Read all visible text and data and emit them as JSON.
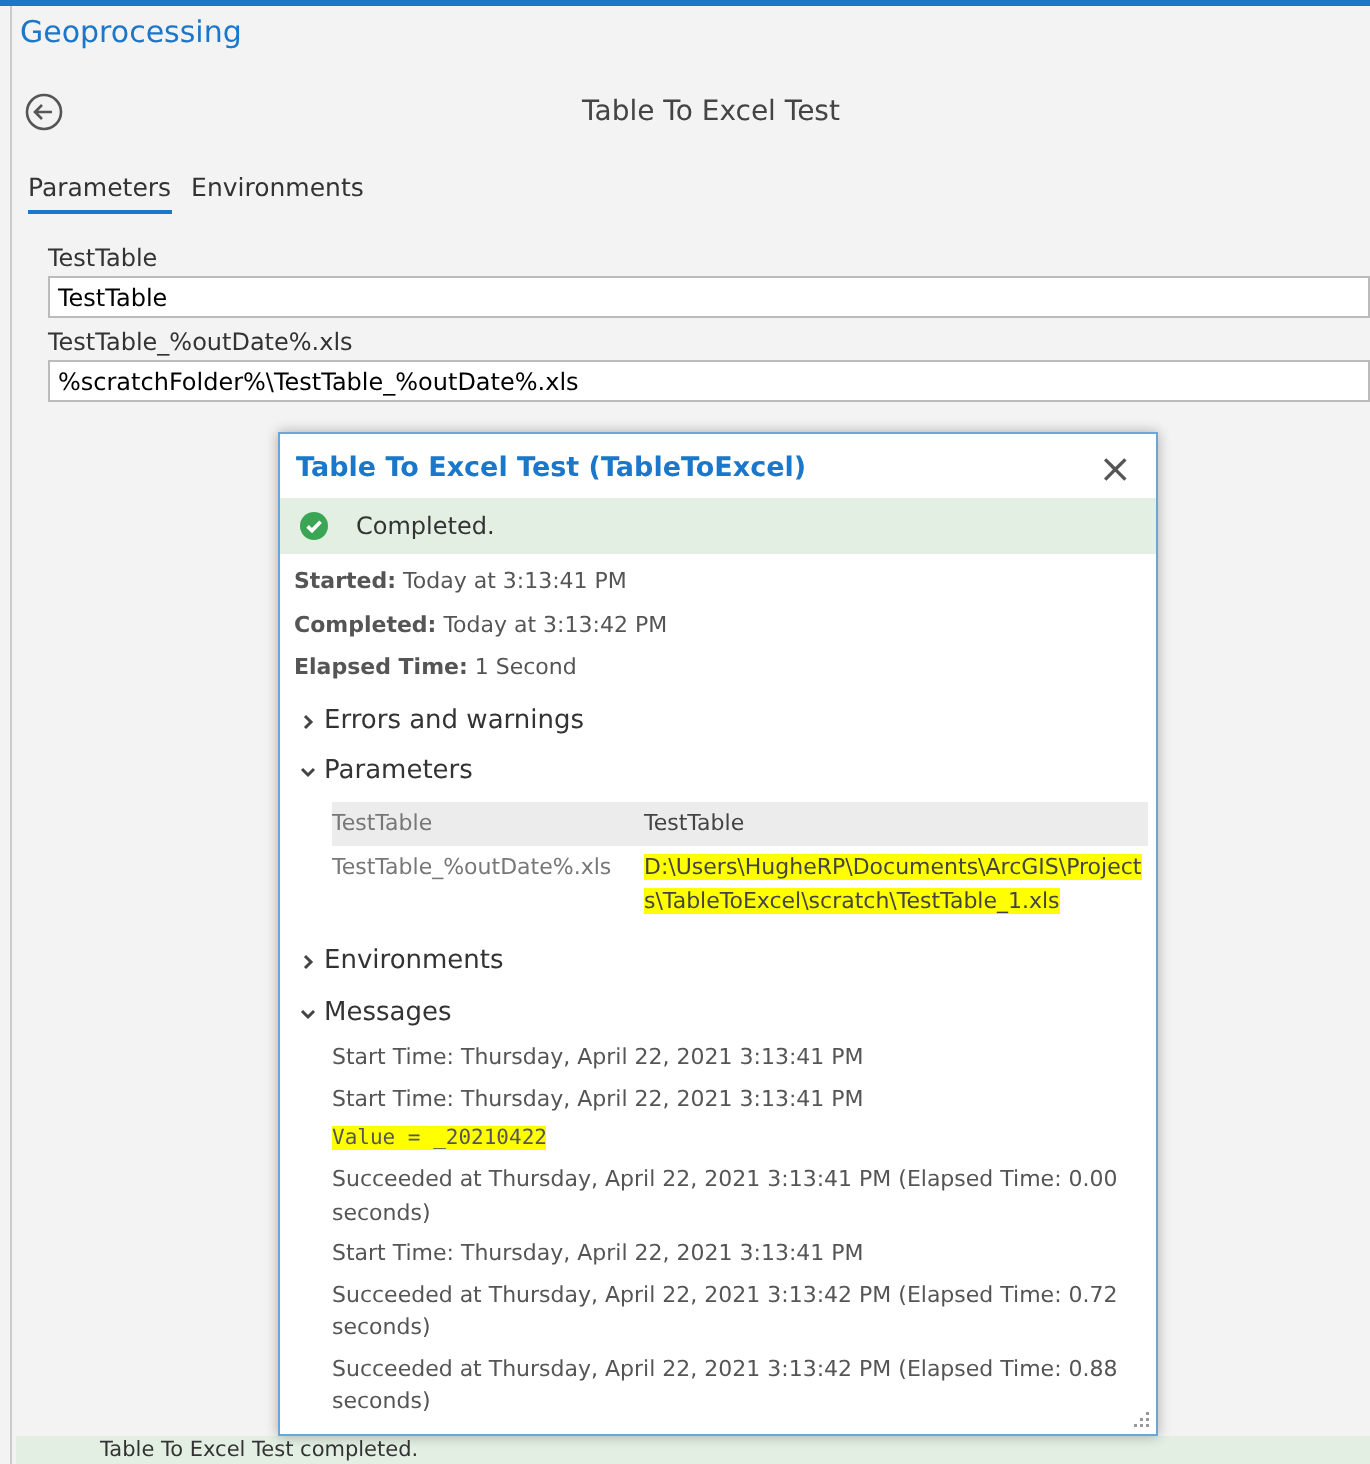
{
  "pane": {
    "title": "Geoprocessing",
    "tool_title": "Table To Excel Test"
  },
  "tabs": [
    {
      "label": "Parameters",
      "selected": true
    },
    {
      "label": "Environments",
      "selected": false
    }
  ],
  "fields": [
    {
      "label": "TestTable",
      "value": "TestTable"
    },
    {
      "label": "TestTable_%outDate%.xls",
      "value": "%scratchFolder%\\TestTable_%outDate%.xls"
    }
  ],
  "dialog": {
    "title": "Table To Excel Test (TableToExcel)",
    "close": "×",
    "status": "Completed.",
    "summary": [
      {
        "label": "Started:",
        "value": "Today at 3:13:41 PM"
      },
      {
        "label": "Completed:",
        "value": "Today at 3:13:42 PM"
      },
      {
        "label": "Elapsed Time:",
        "value": "1 Second"
      }
    ],
    "sections": [
      {
        "title": "Errors and warnings",
        "expanded": false
      },
      {
        "title": "Parameters",
        "expanded": true,
        "kind": "table",
        "rows": [
          {
            "name": "TestTable",
            "value": "TestTable",
            "highlighted": false
          },
          {
            "name": "TestTable_%outDate%.xls",
            "value": "D:\\Users\\HugheRP\\Documents\\ArcGIS\\Projects\\TableToExcel\\scratch\\TestTable_1.xls",
            "highlighted": true
          }
        ]
      },
      {
        "title": "Environments",
        "expanded": false
      },
      {
        "title": "Messages",
        "expanded": true,
        "kind": "messages",
        "messages": [
          {
            "text": "Start Time: Thursday, April 22, 2021 3:13:41 PM",
            "kind": "text",
            "highlighted": false
          },
          {
            "text": "Start Time: Thursday, April 22, 2021 3:13:41 PM",
            "kind": "text",
            "highlighted": false
          },
          {
            "text": "Value = _20210422",
            "kind": "code",
            "highlighted": true
          },
          {
            "text": "Succeeded at Thursday, April 22, 2021 3:13:41 PM (Elapsed Time: 0.00 seconds)",
            "kind": "text",
            "highlighted": false
          },
          {
            "text": "Start Time: Thursday, April 22, 2021 3:13:41 PM",
            "kind": "text",
            "highlighted": false
          },
          {
            "text": "Succeeded at Thursday, April 22, 2021 3:13:42 PM (Elapsed Time: 0.72 seconds)",
            "kind": "text",
            "highlighted": false
          },
          {
            "text": "Succeeded at Thursday, April 22, 2021 3:13:42 PM (Elapsed Time: 0.88 seconds)",
            "kind": "text",
            "highlighted": false
          }
        ]
      }
    ]
  },
  "status_bar": {
    "text": "Table To Excel Test completed."
  }
}
